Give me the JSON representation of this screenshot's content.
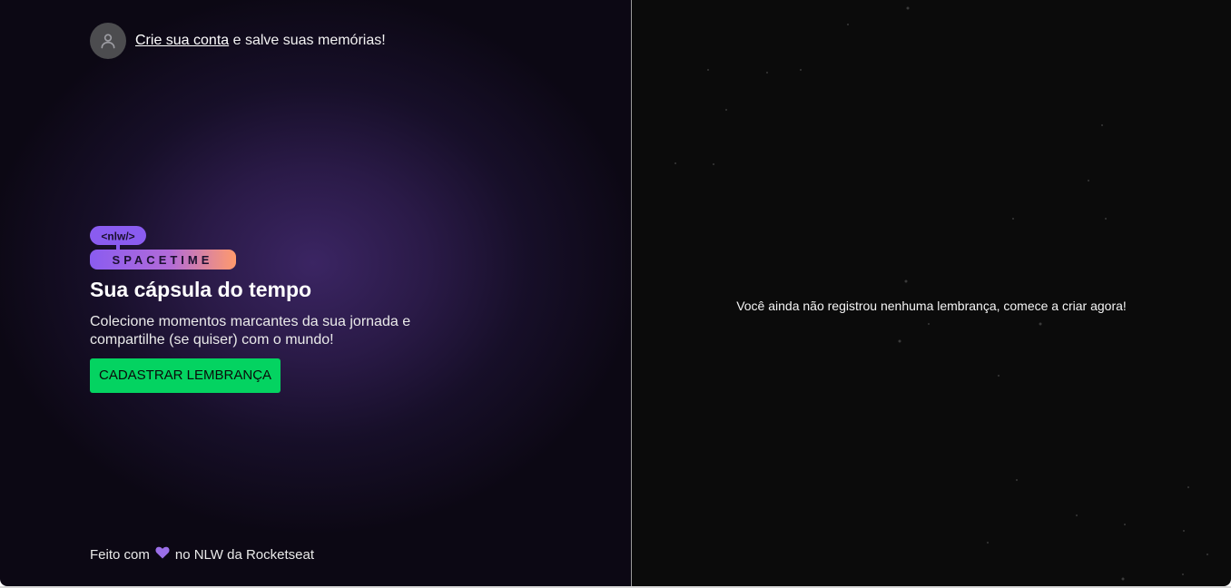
{
  "header": {
    "signup_link": "Crie sua conta",
    "signup_rest": " e salve suas memórias!",
    "avatar_icon": "user-icon"
  },
  "logo": {
    "tag": "<nlw/>",
    "name": "SPACETIME"
  },
  "hero": {
    "title": "Sua cápsula do tempo",
    "description": "Colecione momentos marcantes da sua jornada e compartilhe (se quiser) com o mundo!",
    "cta_label": "CADASTRAR LEMBRANÇA"
  },
  "footer": {
    "prefix": "Feito com",
    "suffix": "no NLW da Rocketseat",
    "heart_icon": "purple-heart-icon"
  },
  "main": {
    "empty_message": "Você ainda não registrou nenhuma lembrança, comece a criar agora!"
  },
  "colors": {
    "accent_green": "#04d361",
    "purple": "#8257e5",
    "logo_gradient_end": "#ff9a6c",
    "right_bg": "#0b0b0b"
  }
}
